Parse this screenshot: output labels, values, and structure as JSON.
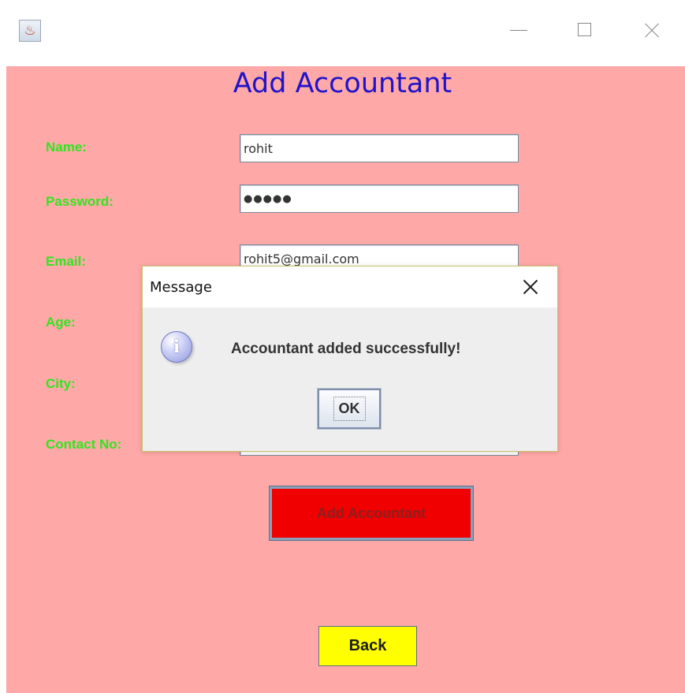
{
  "window": {
    "icon": "java-cup-icon",
    "controls": [
      "minimize-icon",
      "maximize-icon",
      "close-icon"
    ]
  },
  "form": {
    "title": "Add Accountant",
    "fields": [
      {
        "label": "Name:",
        "value": "rohit"
      },
      {
        "label": "Password:",
        "value": "●●●●●"
      },
      {
        "label": "Email:",
        "value": "rohit5@gmail.com"
      },
      {
        "label": "Age:",
        "value": ""
      },
      {
        "label": "City:",
        "value": ""
      },
      {
        "label": "Contact No:",
        "value": ""
      }
    ],
    "add_button": "Add Accountant",
    "back_button": "Back"
  },
  "dialog": {
    "title": "Message",
    "icon": "info-icon",
    "message": "Accountant added successfully!",
    "ok_label": "OK"
  },
  "colors": {
    "panel_bg": "#ffa8a8",
    "title": "#1f14c8",
    "label": "#2fe61e",
    "add_button_bg": "#f00000",
    "back_button_bg": "#ffff00"
  }
}
